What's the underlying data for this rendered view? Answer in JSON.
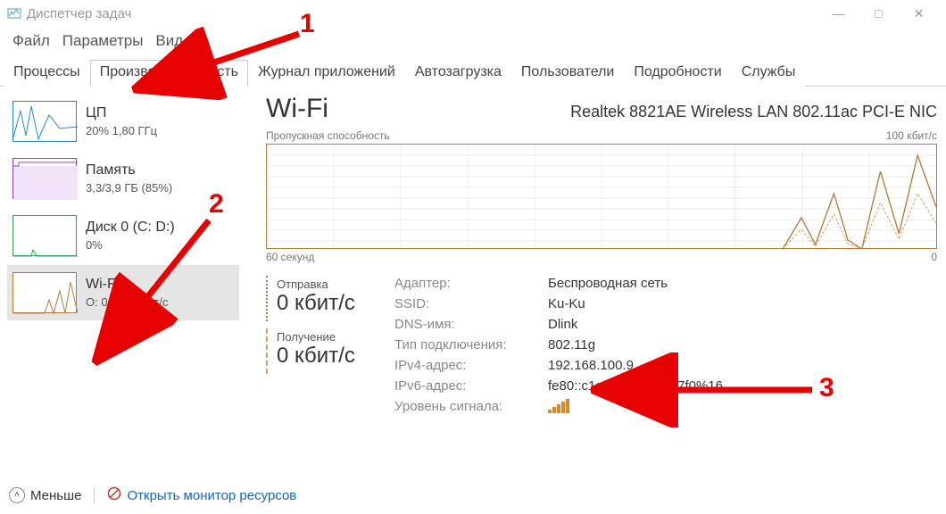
{
  "window": {
    "title": "Диспетчер задач",
    "menu": {
      "file": "Файл",
      "options": "Параметры",
      "view": "Вид"
    },
    "controls": {
      "min": "—",
      "max": "□",
      "close": "✕"
    }
  },
  "tabs": {
    "processes": "Процессы",
    "performance": "Производительность",
    "app_history": "Журнал приложений",
    "startup": "Автозагрузка",
    "users": "Пользователи",
    "details": "Подробности",
    "services": "Службы"
  },
  "sidebar": {
    "cpu": {
      "title": "ЦП",
      "sub": "20%  1,80 ГГц",
      "color": "#2d89c7"
    },
    "mem": {
      "title": "Память",
      "sub": "3,3/3,9 ГБ (85%)",
      "color": "#8e44c2"
    },
    "disk": {
      "title": "Диск 0 (C: D:)",
      "sub": "0%",
      "color": "#3aa655"
    },
    "wifi": {
      "title": "Wi-Fi",
      "sub": "О: 0 П: 0 кбит/с",
      "color": "#b57a3a"
    }
  },
  "main": {
    "title": "Wi-Fi",
    "adapter_name": "Realtek 8821AE Wireless LAN 802.11ac PCI-E NIC",
    "chart": {
      "header": "Пропускная способность",
      "ymax": "100 кбит/с",
      "xleft": "60 секунд",
      "xright": "0"
    },
    "rates": {
      "send_label": "Отправка",
      "send_value": "0 кбит/с",
      "recv_label": "Получение",
      "recv_value": "0 кбит/с"
    },
    "details": {
      "adapter_k": "Адаптер:",
      "adapter_v": "Беспроводная сеть",
      "ssid_k": "SSID:",
      "ssid_v": "Ku-Ku",
      "dns_k": "DNS-имя:",
      "dns_v": "Dlink",
      "conn_k": "Тип подключения:",
      "conn_v": "802.11g",
      "ipv4_k": "IPv4-адрес:",
      "ipv4_v": "192.168.100.9",
      "ipv6_k": "IPv6-адрес:",
      "ipv6_v": "fe80::c1ed:6360:186:f7f0%16",
      "signal_k": "Уровень сигнала:"
    }
  },
  "footer": {
    "fewer": "Меньше",
    "monitor": "Открыть монитор ресурсов"
  },
  "annotations": {
    "n1": "1",
    "n2": "2",
    "n3": "3"
  },
  "chart_data": {
    "type": "line",
    "title": "Пропускная способность",
    "xlabel": "секунд",
    "ylabel": "кбит/с",
    "xlim": [
      60,
      0
    ],
    "ylim": [
      0,
      100
    ],
    "series": [
      {
        "name": "Отправка",
        "x": [
          60,
          55,
          50,
          45,
          40,
          35,
          30,
          25,
          20,
          15,
          12,
          10,
          8,
          6,
          5,
          4,
          3,
          2,
          1,
          0
        ],
        "values": [
          0,
          0,
          0,
          0,
          0,
          0,
          0,
          0,
          0,
          0,
          0,
          30,
          5,
          55,
          10,
          0,
          75,
          15,
          90,
          40
        ]
      },
      {
        "name": "Получение",
        "x": [
          60,
          55,
          50,
          45,
          40,
          35,
          30,
          25,
          20,
          15,
          12,
          10,
          8,
          6,
          5,
          4,
          3,
          2,
          1,
          0
        ],
        "values": [
          0,
          0,
          0,
          0,
          0,
          0,
          0,
          0,
          0,
          0,
          0,
          20,
          3,
          35,
          6,
          0,
          45,
          10,
          55,
          25
        ]
      }
    ]
  }
}
